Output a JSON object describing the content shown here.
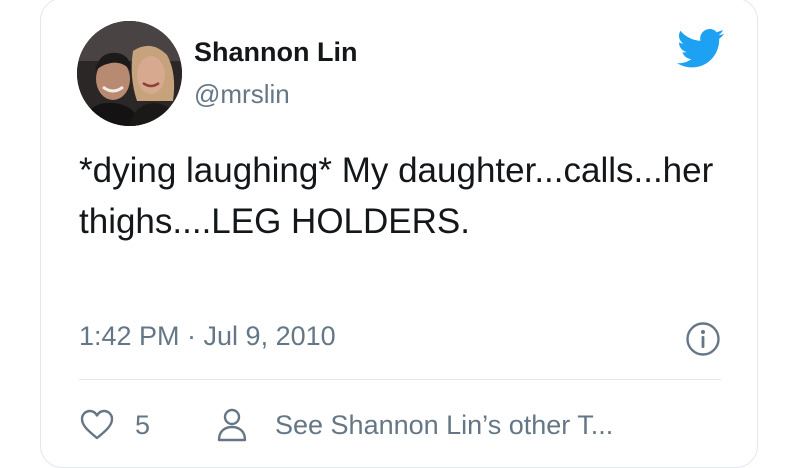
{
  "tweet": {
    "author": {
      "display_name": "Shannon Lin",
      "handle": "@mrslin",
      "avatar": "profile-photo-two-people"
    },
    "text": "*dying laughing* My daughter...calls...her thighs....LEG HOLDERS.",
    "timestamp": "1:42 PM · Jul 9, 2010",
    "like_count": "5",
    "profile_link_label": "See Shannon Lin’s other T...",
    "icons": {
      "brand": "twitter-bird-icon",
      "info": "info-icon",
      "like": "heart-icon",
      "profile": "person-icon"
    },
    "colors": {
      "twitter_blue": "#1da1f2",
      "text": "#14171a",
      "muted": "#657786",
      "border": "#e3e6ea"
    }
  }
}
